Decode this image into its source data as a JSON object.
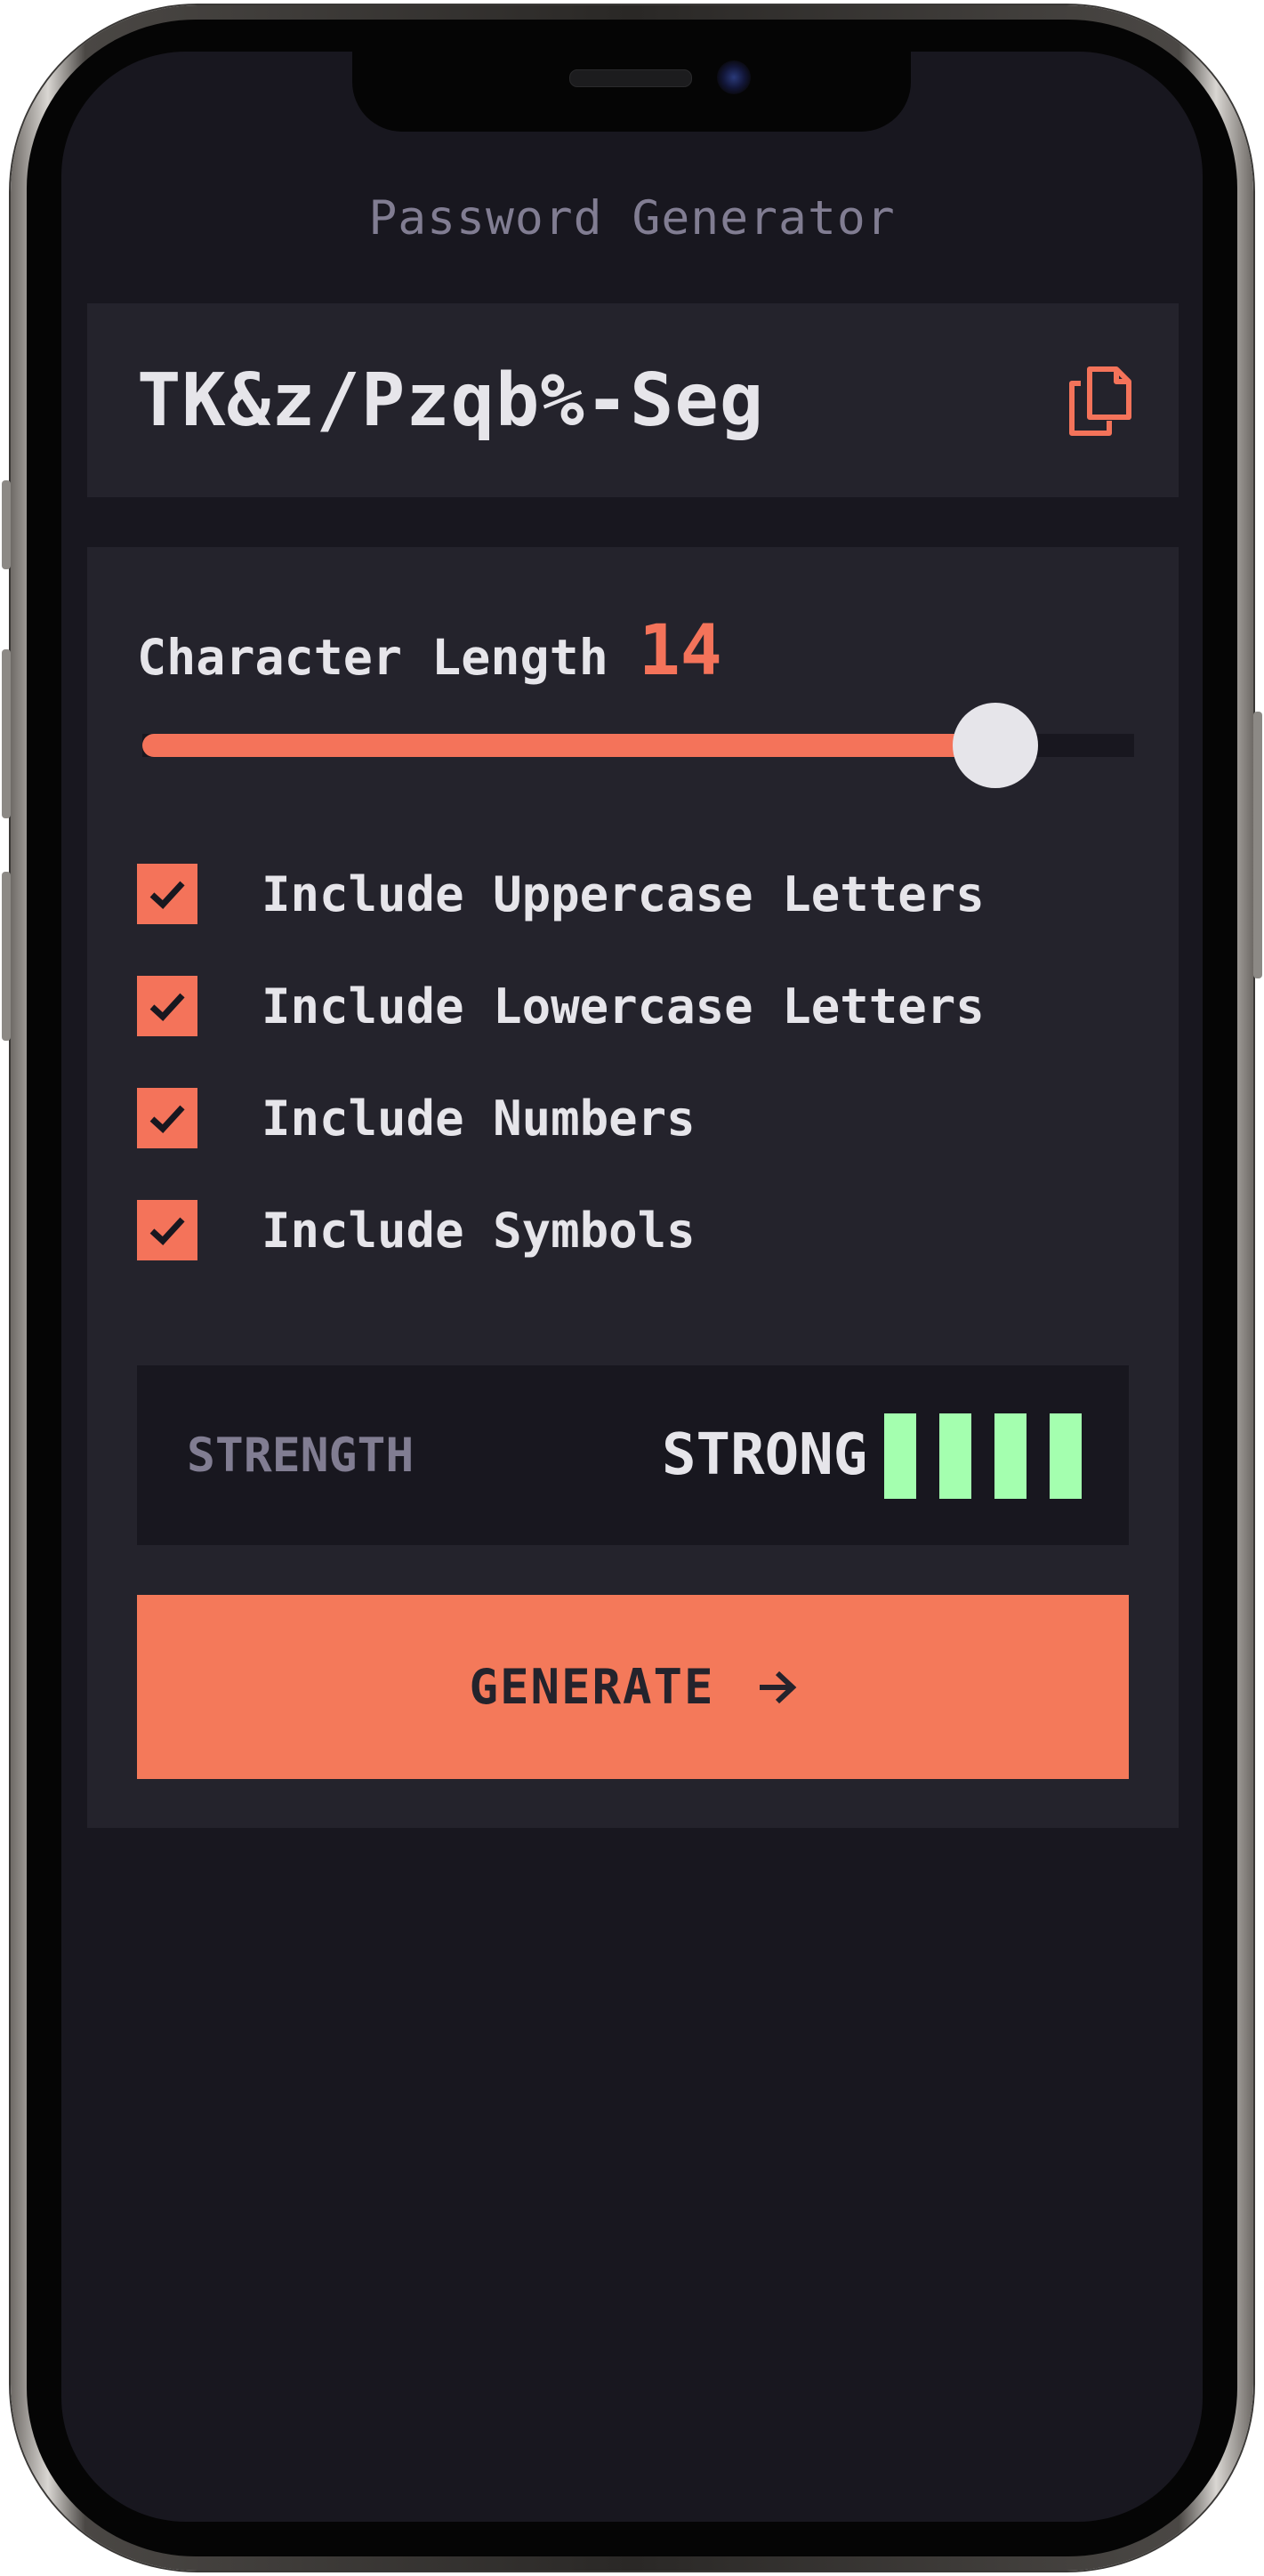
{
  "app": {
    "title": "Password Generator"
  },
  "output": {
    "password": "TK&z/Pzqb%-Seg",
    "copy_icon": "copy-icon"
  },
  "settings": {
    "length_label": "Character Length",
    "length_value": "14",
    "slider": {
      "value": 14,
      "fraction": 0.86
    },
    "options": [
      {
        "label": "Include Uppercase Letters",
        "checked": true
      },
      {
        "label": "Include Lowercase Letters",
        "checked": true
      },
      {
        "label": "Include Numbers",
        "checked": true
      },
      {
        "label": "Include Symbols",
        "checked": true
      }
    ]
  },
  "strength": {
    "label": "STRENGTH",
    "value": "STRONG",
    "bars_filled": 4,
    "bars_total": 4
  },
  "generate": {
    "label": "GENERATE",
    "icon": "arrow-right-icon"
  },
  "colors": {
    "accent": "#F4735A",
    "strong": "#A4FFAF",
    "background": "#18171F",
    "panel": "#24232C",
    "muted": "#817D92",
    "text": "#E6E5EA"
  }
}
